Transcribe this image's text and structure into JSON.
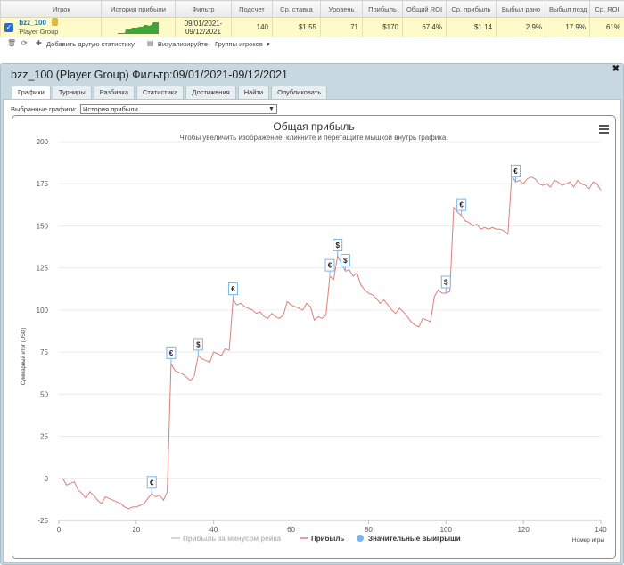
{
  "table": {
    "headers": [
      "Игрок",
      "История прибыли",
      "Фильтр",
      "Подсчет",
      "Ср. ставка",
      "Уровень",
      "Прибыль",
      "Общий ROI",
      "Ср. прибыль",
      "Выбыл рано",
      "Выбыл позд",
      "Ср. ROI"
    ],
    "row": {
      "player_name": "bzz_100",
      "player_group": "Player Group",
      "filter_line1": "09/01/2021-",
      "filter_line2": "09/12/2021",
      "count": "140",
      "avg_stake": "$1.55",
      "level": "71",
      "profit": "$170",
      "total_roi": "67.4%",
      "avg_profit": "$1.14",
      "early_out": "2.9%",
      "late_out": "17.9%",
      "avg_roi": "61%"
    }
  },
  "toolbar": {
    "add_stat": "Добавить другую статистику",
    "visualize": "Визуализируйте",
    "player_groups": "Группы игроков"
  },
  "panel": {
    "title": "bzz_100 (Player Group) Фильтр:09/01/2021-09/12/2021",
    "tabs": [
      "Графики",
      "Турниры",
      "Разбивка",
      "Статистика",
      "Достижения",
      "Найти",
      "Опубликовать"
    ],
    "active_tab": 0,
    "select_label": "Выбранные графики:",
    "select_value": "История прибыли"
  },
  "chart_data": {
    "type": "line",
    "title": "Общая прибыль",
    "subtitle": "Чтобы увеличить изображение, кликните и перетащите мышкой внутрь графика.",
    "ylabel": "Суммарный итог (USD)",
    "xlabel": "Номер игры",
    "xlim": [
      0,
      140
    ],
    "ylim": [
      -25,
      200
    ],
    "x_ticks": [
      0,
      20,
      40,
      60,
      80,
      100,
      120,
      140
    ],
    "y_ticks": [
      -25,
      0,
      25,
      50,
      75,
      100,
      125,
      150,
      175,
      200
    ],
    "legend": [
      "Прибыль за минусом рейка",
      "Прибыль",
      "Значительные выигрыши"
    ],
    "legend_position": "bottom",
    "line_color": "#d9807a",
    "series": [
      {
        "name": "Прибыль",
        "x": [
          1,
          2,
          3,
          4,
          5,
          6,
          7,
          8,
          9,
          10,
          11,
          12,
          13,
          14,
          15,
          16,
          17,
          18,
          19,
          20,
          21,
          22,
          23,
          24,
          25,
          26,
          27,
          28,
          29,
          30,
          31,
          32,
          33,
          34,
          35,
          36,
          37,
          38,
          39,
          40,
          41,
          42,
          43,
          44,
          45,
          46,
          47,
          48,
          49,
          50,
          51,
          52,
          53,
          54,
          55,
          56,
          57,
          58,
          59,
          60,
          61,
          62,
          63,
          64,
          65,
          66,
          67,
          68,
          69,
          70,
          71,
          72,
          73,
          74,
          75,
          76,
          77,
          78,
          79,
          80,
          81,
          82,
          83,
          84,
          85,
          86,
          87,
          88,
          89,
          90,
          91,
          92,
          93,
          94,
          95,
          96,
          97,
          98,
          99,
          100,
          101,
          102,
          103,
          104,
          105,
          106,
          107,
          108,
          109,
          110,
          111,
          112,
          113,
          114,
          115,
          116,
          117,
          118,
          119,
          120,
          121,
          122,
          123,
          124,
          125,
          126,
          127,
          128,
          129,
          130,
          131,
          132,
          133,
          134,
          135,
          136,
          137,
          138,
          139,
          140
        ],
        "y": [
          0,
          -4,
          -3,
          -2,
          -7,
          -9,
          -12,
          -8,
          -10,
          -13,
          -15,
          -11,
          -12,
          -13,
          -14,
          -15,
          -17,
          -18,
          -17,
          -17,
          -16,
          -15,
          -12,
          -9,
          -11,
          -10,
          -13,
          -8,
          68,
          64,
          63,
          62,
          60,
          58,
          61,
          73,
          71,
          70,
          69,
          75,
          74,
          73,
          77,
          76,
          106,
          103,
          104,
          102,
          101,
          100,
          98,
          99,
          96,
          95,
          98,
          96,
          95,
          97,
          105,
          103,
          102,
          101,
          100,
          104,
          102,
          94,
          96,
          95,
          97,
          120,
          118,
          132,
          128,
          123,
          124,
          120,
          122,
          115,
          112,
          110,
          109,
          107,
          104,
          106,
          103,
          100,
          98,
          101,
          99,
          96,
          93,
          91,
          90,
          95,
          94,
          93,
          108,
          112,
          110,
          110,
          111,
          161,
          158,
          156,
          153,
          152,
          150,
          151,
          148,
          149,
          148,
          149,
          148,
          148,
          147,
          145,
          180,
          176,
          177,
          175,
          178,
          179,
          178,
          175,
          174,
          175,
          173,
          177,
          176,
          174,
          175,
          176,
          173,
          177,
          175,
          174,
          172,
          176,
          175,
          171
        ]
      }
    ],
    "significant_wins": [
      {
        "x": 24,
        "symbol": "€"
      },
      {
        "x": 29,
        "symbol": "€"
      },
      {
        "x": 36,
        "symbol": "$"
      },
      {
        "x": 45,
        "symbol": "€"
      },
      {
        "x": 70,
        "symbol": "€"
      },
      {
        "x": 72,
        "symbol": "$"
      },
      {
        "x": 74,
        "symbol": "$"
      },
      {
        "x": 100,
        "symbol": "$"
      },
      {
        "x": 104,
        "symbol": "€"
      },
      {
        "x": 118,
        "symbol": "€"
      }
    ]
  }
}
